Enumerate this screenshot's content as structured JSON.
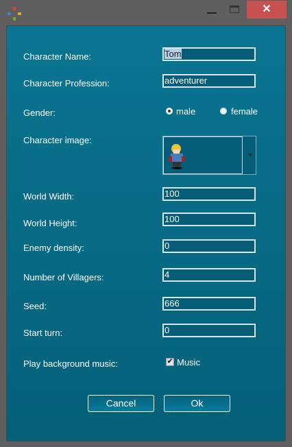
{
  "window": {
    "icon": "app-compass-icon",
    "minimize_icon": "minimize-icon",
    "maximize_icon": "maximize-icon",
    "close_icon": "close-icon",
    "close_glyph": "✕"
  },
  "form": {
    "name_label": "Character Name:",
    "name_value": "Tom",
    "profession_label": "Character Profession:",
    "profession_value": "adventurer",
    "gender_label": "Gender:",
    "gender_options": [
      "male",
      "female"
    ],
    "gender_selected": "male",
    "image_label": "Character image:",
    "image_selected": "blonde armored knight sprite",
    "width_label": "World Width:",
    "width_value": "100",
    "height_label": "World Height:",
    "height_value": "100",
    "enemy_label": "Enemy density:",
    "enemy_value": "0",
    "villagers_label": "Number of Villagers:",
    "villagers_value": "4",
    "seed_label": "Seed:",
    "seed_value": "666",
    "turn_label": "Start turn:",
    "turn_value": "0",
    "music_label": "Play background music:",
    "music_checkbox_label": "Music",
    "music_checked": true
  },
  "buttons": {
    "cancel": "Cancel",
    "ok": "Ok"
  },
  "colors": {
    "frame": "#5f5f5f",
    "close": "#c75050",
    "panel_top": "#0a7592",
    "panel_bottom": "#056079"
  }
}
